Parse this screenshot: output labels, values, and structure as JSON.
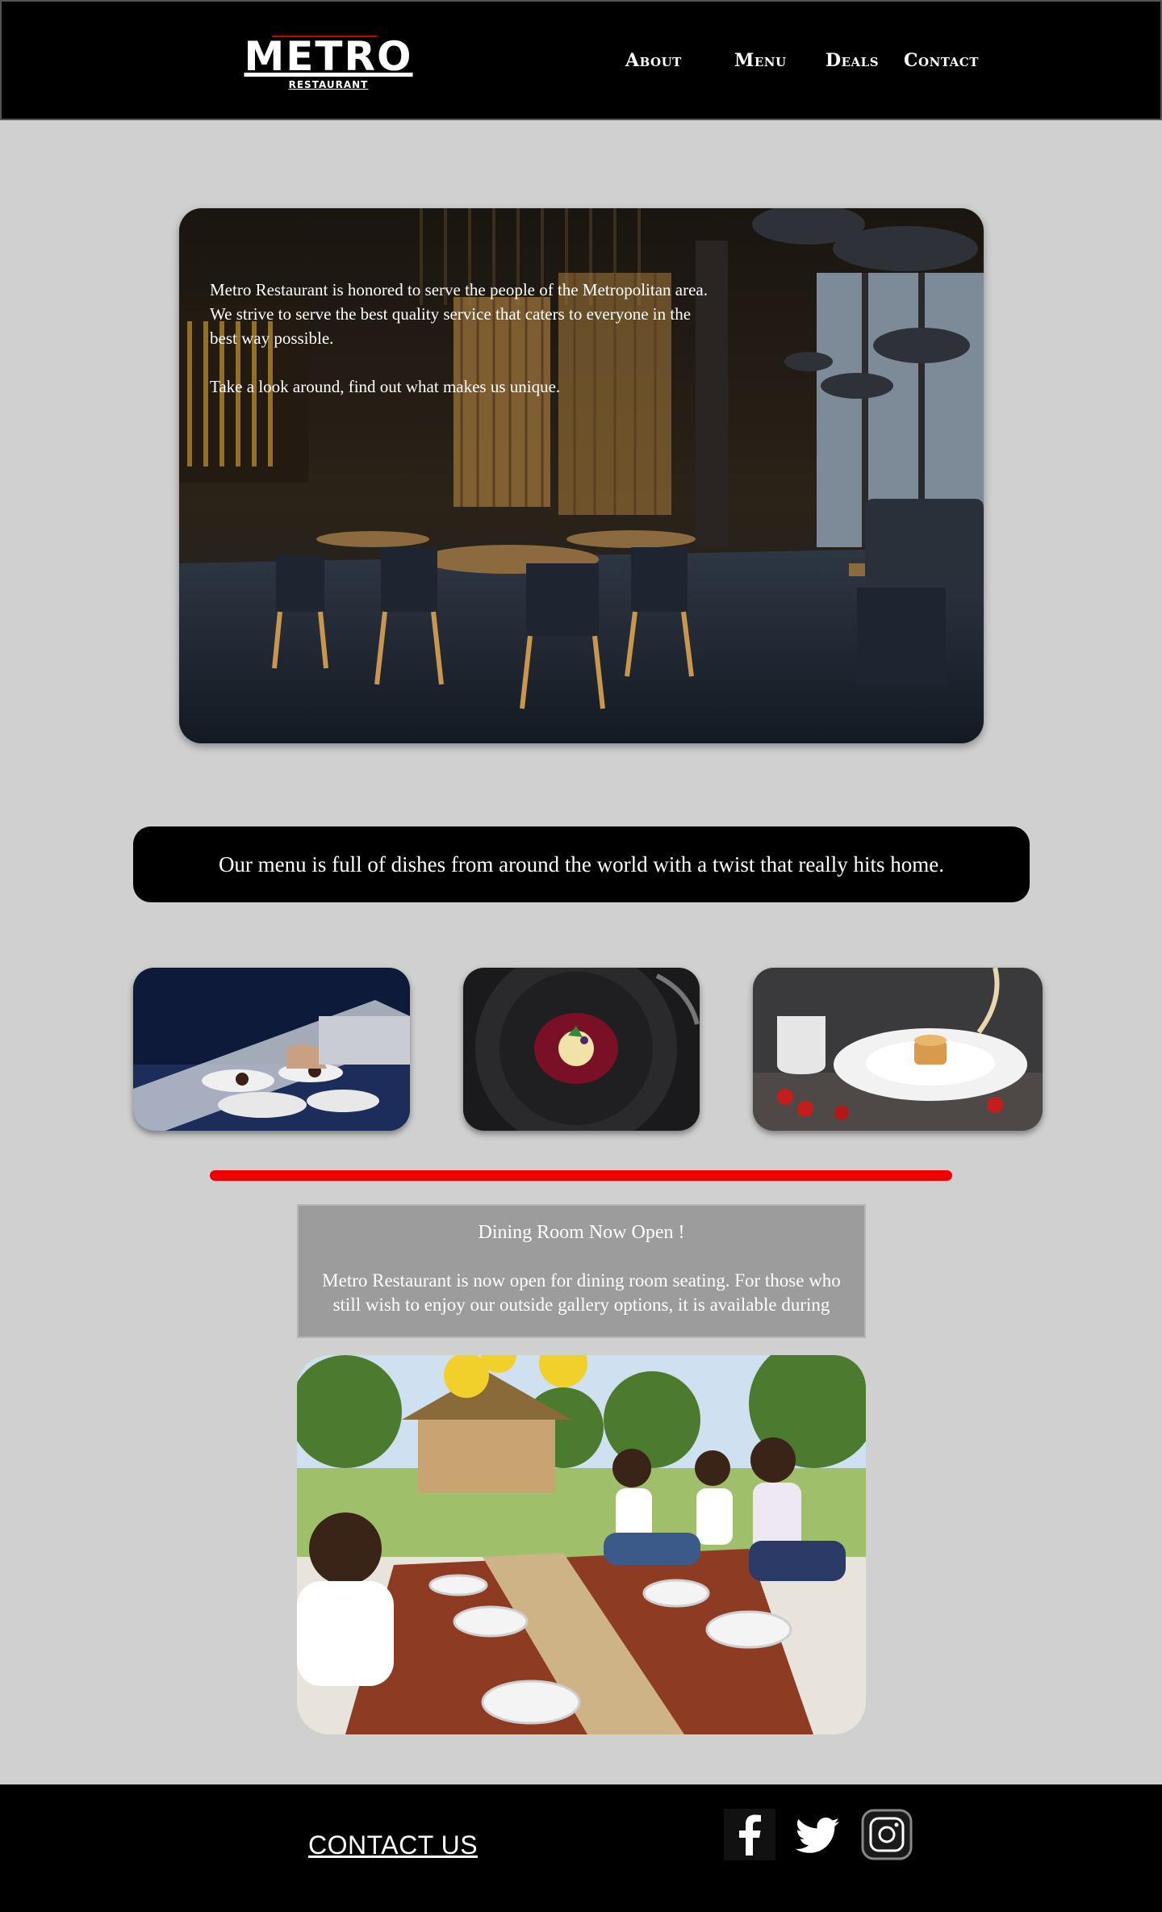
{
  "header": {
    "logo_main": "METRO",
    "logo_sub": "RESTAURANT",
    "nav": [
      "About",
      "Menu",
      "Deals",
      "Contact"
    ]
  },
  "hero": {
    "paragraph1": "Metro Restaurant is honored to serve the people of the Metropolitan area.  We strive to serve the best quality service that caters to everyone in the best way possible.",
    "paragraph2": "Take a look around, find out what makes us unique."
  },
  "banner": {
    "text": "Our menu is full of dishes from around the world with a twist that really hits home."
  },
  "notice": {
    "title": "Dining Room Now Open !",
    "body": "Metro Restaurant is now open for dining room seating. For those who still wish to enjoy our outside gallery options, it is available during"
  },
  "footer": {
    "contact_label": "CONTACT US",
    "social_icons": [
      "facebook-icon",
      "twitter-icon",
      "instagram-icon"
    ]
  },
  "colors": {
    "header_bg": "#000000",
    "page_bg": "#d0d0d0",
    "accent_red": "#ee0000",
    "notice_bg": "#9c9c9c"
  }
}
